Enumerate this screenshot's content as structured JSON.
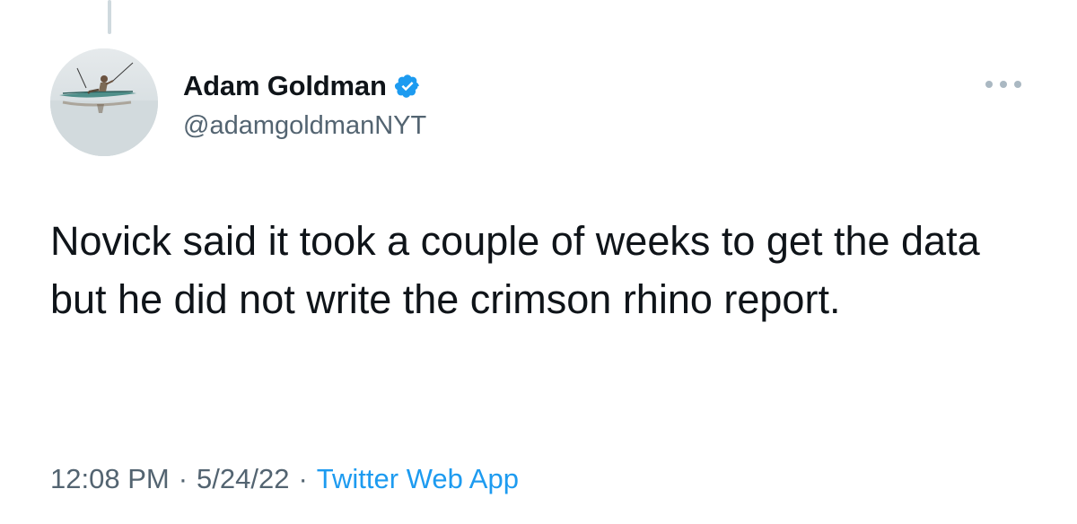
{
  "tweet": {
    "author": {
      "display_name": "Adam Goldman",
      "handle": "@adamgoldmanNYT",
      "verified": true,
      "avatar_icon": "person-in-kayak-avatar"
    },
    "text": "Novick said it took a couple of weeks to get the data but he did not write the crimson rhino report.",
    "time": "12:08 PM",
    "date": "5/24/22",
    "separator": "·",
    "source": "Twitter Web App",
    "more_icon": "more-options-icon"
  },
  "colors": {
    "text": "#0f1419",
    "secondary": "#536471",
    "link": "#1d9bf0",
    "verified_badge": "#1d9bf0",
    "thread_line": "#cfd9de"
  }
}
